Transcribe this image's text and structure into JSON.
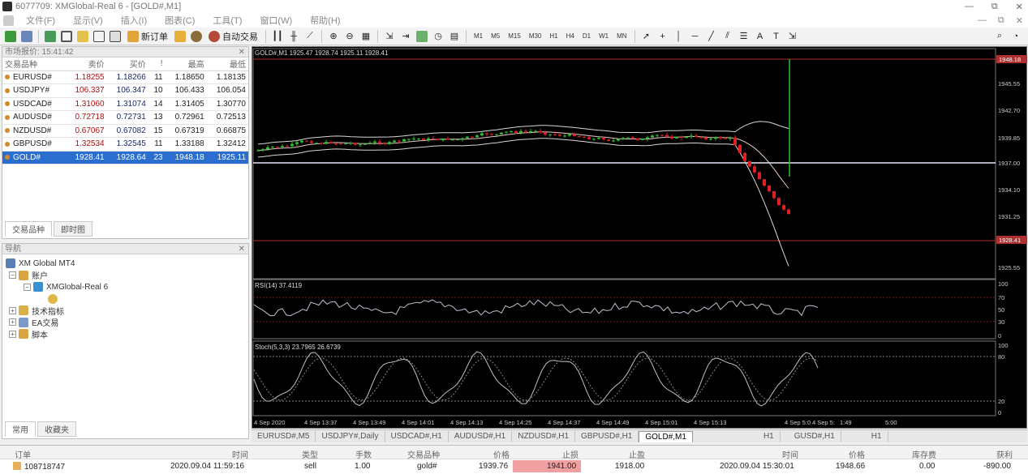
{
  "window": {
    "title": "6077709: XMGlobal-Real 6 - [GOLD#,M1]",
    "controls": [
      "—",
      "⧉",
      "✕"
    ]
  },
  "menu": [
    "文件(F)",
    "显示(V)",
    "插入(I)",
    "图表(C)",
    "工具(T)",
    "窗口(W)",
    "帮助(H)"
  ],
  "toolbar": {
    "new_order": "新订单",
    "auto_trade": "自动交易",
    "timeframes": [
      "M1",
      "M5",
      "M15",
      "M30",
      "H1",
      "H4",
      "D1",
      "W1",
      "MN"
    ]
  },
  "market_watch": {
    "caption": "市场报价: 15:41:42",
    "headers": [
      "交易品种",
      "卖价",
      "买价",
      "!",
      "最高",
      "最低"
    ],
    "rows": [
      {
        "symbol": "EURUSD#",
        "bid": "1.18255",
        "ask": "1.18266",
        "spread": "11",
        "high": "1.18650",
        "low": "1.18135"
      },
      {
        "symbol": "USDJPY#",
        "bid": "106.337",
        "ask": "106.347",
        "spread": "10",
        "high": "106.433",
        "low": "106.054"
      },
      {
        "symbol": "USDCAD#",
        "bid": "1.31060",
        "ask": "1.31074",
        "spread": "14",
        "high": "1.31405",
        "low": "1.30770"
      },
      {
        "symbol": "AUDUSD#",
        "bid": "0.72718",
        "ask": "0.72731",
        "spread": "13",
        "high": "0.72961",
        "low": "0.72513"
      },
      {
        "symbol": "NZDUSD#",
        "bid": "0.67067",
        "ask": "0.67082",
        "spread": "15",
        "high": "0.67319",
        "low": "0.66875"
      },
      {
        "symbol": "GBPUSD#",
        "bid": "1.32534",
        "ask": "1.32545",
        "spread": "11",
        "high": "1.33188",
        "low": "1.32412"
      },
      {
        "symbol": "GOLD#",
        "bid": "1928.41",
        "ask": "1928.64",
        "spread": "23",
        "high": "1948.18",
        "low": "1925.11"
      }
    ],
    "tabs": [
      "交易品种",
      "即时图"
    ]
  },
  "navigator": {
    "caption": "导航",
    "items": [
      {
        "label": "XM Global MT4",
        "level": 0
      },
      {
        "label": "账户",
        "level": 1
      },
      {
        "label": "XMGlobal-Real 6",
        "level": 2
      },
      {
        "label": "",
        "level": 3
      },
      {
        "label": "技术指标",
        "level": 1
      },
      {
        "label": "EA交易",
        "level": 1
      },
      {
        "label": "脚本",
        "level": 1
      }
    ],
    "tabs": [
      "常用",
      "收藏夹"
    ]
  },
  "chart": {
    "header": "GOLD#,M1  1925.47 1928.74 1925.11 1928.41",
    "price_labels": [
      "1945.55",
      "1942.70",
      "1939.85",
      "1937.00",
      "1934.10",
      "1931.25",
      "1928.41",
      "1925.55"
    ],
    "current_price": "1928.41",
    "top_price_label": "1948.18",
    "rsi_label": "RSI(14) 37.4119",
    "rsi_scale": [
      "100",
      "70",
      "50",
      "30",
      "0"
    ],
    "stoch_label": "Stoch(5,3,3) 23.7965 26.6739",
    "stoch_scale": [
      "100",
      "80",
      "20",
      "0"
    ],
    "time_labels": [
      "4 Sep 2020",
      "4 Sep 13:37",
      "4 Sep 13:49",
      "4 Sep 14:01",
      "4 Sep 14:13",
      "4 Sep 14:25",
      "4 Sep 14:37",
      "4 Sep 14:49",
      "4 Sep 15:01",
      "4 Sep 15:13",
      "4 Sep 5:0",
      "4 Sep 5:",
      "1:49",
      "5:00"
    ]
  },
  "symbol_tabs": [
    "EURUSD#,M5",
    "USDJPY#,Daily",
    "USDCAD#,H1",
    "AUDUSD#,H1",
    "NZDUSD#,H1",
    "GBPUSD#,H1",
    "GOLD#,M1",
    "H1",
    "GUSD#,H1",
    "H1"
  ],
  "orders": {
    "headers": [
      "订单",
      "时间",
      "类型",
      "手数",
      "交易品种",
      "价格",
      "止损",
      "止盈",
      "时间",
      "价格",
      "库存费",
      "获利"
    ],
    "rows": [
      {
        "ticket": "108718747",
        "open_time": "2020.09.04 11:59:16",
        "type": "sell",
        "lots": "1.00",
        "symbol": "gold#",
        "open_price": "1939.76",
        "sl": "1941.00",
        "tp": "1918.00",
        "close_time": "2020.09.04 15:30:01",
        "close_price": "1948.66",
        "swap": "0.00",
        "profit": "-890.00"
      }
    ]
  }
}
